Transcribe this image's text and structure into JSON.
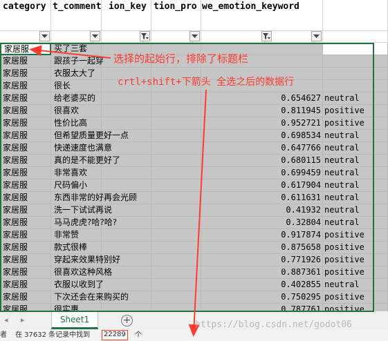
{
  "headers": {
    "col1": "category",
    "col2": "t_comment",
    "col3": "ion_key",
    "col4": "tion_pro",
    "col5": "we_emotion_keyword"
  },
  "rows": [
    {
      "category": "家居服",
      "comment": "买了三套",
      "value": "",
      "emotion": ""
    },
    {
      "category": "家居服",
      "comment": "跟孩子一起穿",
      "value": "",
      "emotion": ""
    },
    {
      "category": "家居服",
      "comment": "衣服太大了",
      "value": "",
      "emotion": ""
    },
    {
      "category": "家居服",
      "comment": "很长",
      "value": "",
      "emotion": ""
    },
    {
      "category": "家居服",
      "comment": "给老婆买的",
      "value": "0.654627",
      "emotion": "neutral"
    },
    {
      "category": "家居服",
      "comment": "很喜欢",
      "value": "0.811945",
      "emotion": "positive"
    },
    {
      "category": "家居服",
      "comment": "性价比高",
      "value": "0.952721",
      "emotion": "positive"
    },
    {
      "category": "家居服",
      "comment": "但希望质量更好一点",
      "value": "0.698534",
      "emotion": "neutral"
    },
    {
      "category": "家居服",
      "comment": "快递速度也满意",
      "value": "0.647766",
      "emotion": "neutral"
    },
    {
      "category": "家居服",
      "comment": "真的是不能更好了",
      "value": "0.680115",
      "emotion": "neutral"
    },
    {
      "category": "家居服",
      "comment": "非常喜欢",
      "value": "0.699459",
      "emotion": "neutral"
    },
    {
      "category": "家居服",
      "comment": "尺码偏小",
      "value": "0.617904",
      "emotion": "neutral"
    },
    {
      "category": "家居服",
      "comment": "东西非常的好再会光顾",
      "value": "0.611631",
      "emotion": "neutral"
    },
    {
      "category": "家居服",
      "comment": "洗一下试试再说",
      "value": "0.41932",
      "emotion": "neutral"
    },
    {
      "category": "家居服",
      "comment": "马马虎虎?哈?哈?",
      "value": "0.32804",
      "emotion": "neutral"
    },
    {
      "category": "家居服",
      "comment": "非常赞",
      "value": "0.917874",
      "emotion": "positive"
    },
    {
      "category": "家居服",
      "comment": "款式很棒",
      "value": "0.875658",
      "emotion": "positive"
    },
    {
      "category": "家居服",
      "comment": "穿起来效果特别好",
      "value": "0.771926",
      "emotion": "positive"
    },
    {
      "category": "家居服",
      "comment": "很喜欢这种风格",
      "value": "0.887361",
      "emotion": "positive"
    },
    {
      "category": "家居服",
      "comment": "衣服以收到了",
      "value": "0.402855",
      "emotion": "neutral"
    },
    {
      "category": "家居服",
      "comment": "下次还会在来购买的",
      "value": "0.750295",
      "emotion": "positive"
    },
    {
      "category": "家居服",
      "comment": "很实惠",
      "value": "0.787761",
      "emotion": "positive"
    }
  ],
  "annotations": {
    "start_row_note": "选择的起始行，排除了标题栏",
    "shortcut_note": "crtl+shift+下箭头 全选之后的数据行"
  },
  "sheet_tab": "Sheet1",
  "add_sheet": "+",
  "status": {
    "left": "者",
    "found": "在 37632 条记录中找到",
    "count": "22289",
    "unit": "个"
  },
  "watermark": "https://blog.csdn.net/godot06",
  "colors": {
    "selection": "#c6c6c6",
    "excel_green": "#217346",
    "annotation_red": "#ff3b2f"
  },
  "icons": {
    "filter_dropdown": "triangle-down",
    "filter_active": "funnel"
  }
}
